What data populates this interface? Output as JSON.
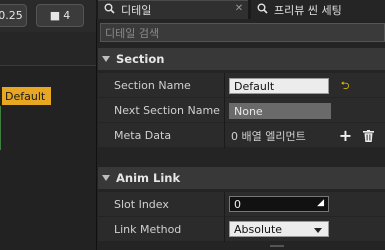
{
  "viewport_toolbar": {
    "value_button": "0.25",
    "camera_speed": "4"
  },
  "viewport": {
    "section_chip": "Default"
  },
  "tabs": [
    {
      "label": "디테일"
    },
    {
      "label": "프리뷰 씬 세팅"
    }
  ],
  "search": {
    "placeholder": "디테일 검색"
  },
  "section_category": {
    "title": "Section",
    "rows": [
      {
        "label": "Section Name",
        "value": "Default"
      },
      {
        "label": "Next Section Name",
        "value": "None"
      },
      {
        "label": "Meta Data",
        "value": "0 배열 엘리먼트"
      }
    ]
  },
  "anim_link_category": {
    "title": "Anim Link",
    "rows": [
      {
        "label": "Slot Index",
        "value": "0"
      },
      {
        "label": "Link Method",
        "value": "Absolute"
      }
    ]
  },
  "colors": {
    "section_chip": "#e7a722",
    "reset_arrow": "#e6c200"
  }
}
